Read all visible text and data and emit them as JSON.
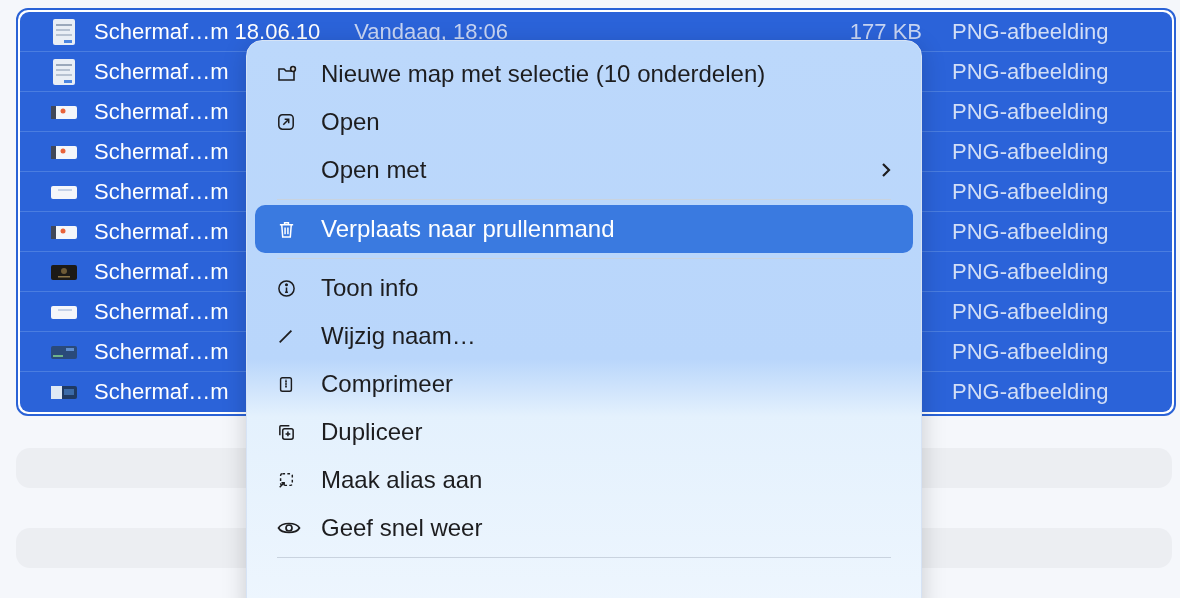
{
  "file_list": {
    "rows": [
      {
        "name": "Schermaf…m 18.06.10",
        "date": "Vandaag, 18:06",
        "size": "177 KB",
        "kind": "PNG-afbeelding",
        "selected": true
      },
      {
        "name": "Schermaf…m",
        "kind": "PNG-afbeelding",
        "selected": true
      },
      {
        "name": "Schermaf…m",
        "kind": "PNG-afbeelding",
        "selected": true
      },
      {
        "name": "Schermaf…m",
        "kind": "PNG-afbeelding",
        "selected": true
      },
      {
        "name": "Schermaf…m",
        "kind": "PNG-afbeelding",
        "selected": true
      },
      {
        "name": "Schermaf…m",
        "kind": "PNG-afbeelding",
        "selected": true
      },
      {
        "name": "Schermaf…m",
        "kind": "PNG-afbeelding",
        "selected": true
      },
      {
        "name": "Schermaf…m",
        "kind": "PNG-afbeelding",
        "selected": true
      },
      {
        "name": "Schermaf…m",
        "kind": "PNG-afbeelding",
        "selected": true
      },
      {
        "name": "Schermaf…m",
        "kind": "PNG-afbeelding",
        "selected": true
      }
    ]
  },
  "context_menu": {
    "items": [
      {
        "kind": "item",
        "label": "Nieuwe map met selectie (10 onderdelen)",
        "selected": false
      },
      {
        "kind": "item",
        "label": "Open",
        "selected": false
      },
      {
        "kind": "submenu",
        "label": "Open met",
        "selected": false
      },
      {
        "kind": "separator"
      },
      {
        "kind": "item",
        "label": "Verplaats naar prullenmand",
        "selected": true
      },
      {
        "kind": "separator"
      },
      {
        "kind": "item",
        "label": "Toon info",
        "selected": false
      },
      {
        "kind": "item",
        "label": "Wijzig naam…",
        "selected": false
      },
      {
        "kind": "item",
        "label": "Comprimeer",
        "selected": false
      },
      {
        "kind": "item",
        "label": "Dupliceer",
        "selected": false
      },
      {
        "kind": "item",
        "label": "Maak alias aan",
        "selected": false
      },
      {
        "kind": "item",
        "label": "Geef snel weer",
        "selected": false
      },
      {
        "kind": "separator"
      }
    ]
  }
}
